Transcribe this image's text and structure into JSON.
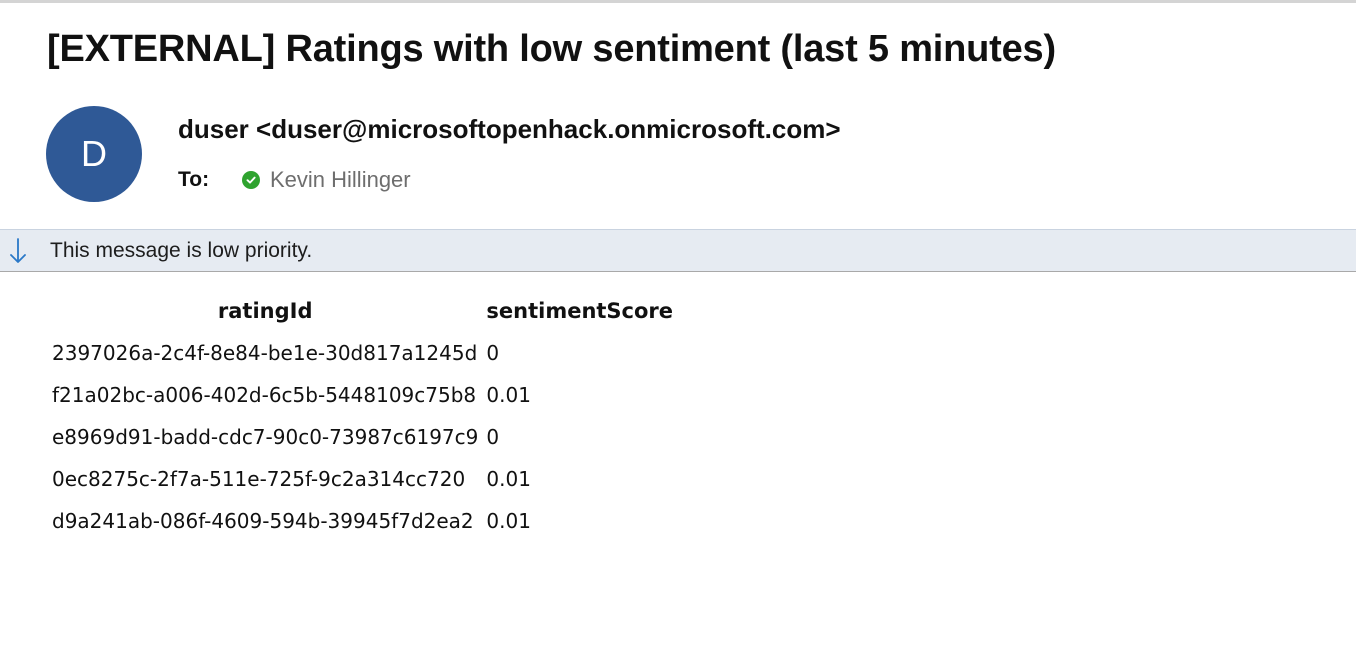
{
  "email": {
    "subject": "[EXTERNAL] Ratings with low sentiment (last 5 minutes)",
    "sender": {
      "initial": "D",
      "display": "duser <duser@microsoftopenhack.onmicrosoft.com>",
      "avatar_color": "#2f5996"
    },
    "to_label": "To:",
    "recipient": "Kevin Hillinger",
    "priority_notice": "This message is low priority."
  },
  "table": {
    "headers": [
      "ratingId",
      "sentimentScore"
    ],
    "rows": [
      {
        "ratingId": "2397026a-2c4f-8e84-be1e-30d817a1245d",
        "sentimentScore": "0"
      },
      {
        "ratingId": "f21a02bc-a006-402d-6c5b-5448109c75b8",
        "sentimentScore": "0.01"
      },
      {
        "ratingId": "e8969d91-badd-cdc7-90c0-73987c6197c9",
        "sentimentScore": "0"
      },
      {
        "ratingId": "0ec8275c-2f7a-511e-725f-9c2a314cc720",
        "sentimentScore": "0.01"
      },
      {
        "ratingId": "d9a241ab-086f-4609-594b-39945f7d2ea2",
        "sentimentScore": "0.01"
      }
    ]
  },
  "icons": {
    "check": "check-circle-icon",
    "priority": "arrow-down-icon"
  },
  "colors": {
    "check_green": "#2fa32f",
    "priority_bar": "#e6ebf2",
    "priority_arrow": "#2a78c8"
  }
}
